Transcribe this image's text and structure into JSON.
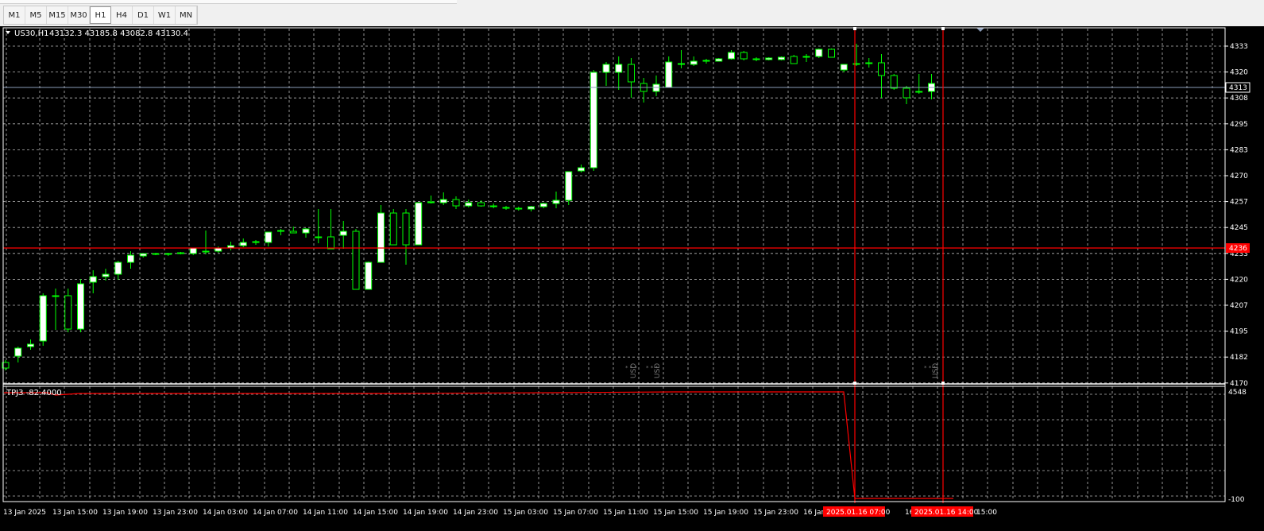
{
  "timeframes": [
    "M1",
    "M5",
    "M15",
    "M30",
    "H1",
    "H4",
    "D1",
    "W1",
    "MN"
  ],
  "active_timeframe": "H1",
  "chart": {
    "symbol_label": "US30,H1",
    "ohlc": "43132.3 43185.8 43082.8 43130.4",
    "price_axis": [
      "4333",
      "4320",
      "4308",
      "4295",
      "4283",
      "4270",
      "4257",
      "4245",
      "4233",
      "4220",
      "4207",
      "4195",
      "4182",
      "4170"
    ],
    "current_price_label": "4313",
    "red_line_price_label": "4236",
    "time_axis": [
      "13 Jan 2025",
      "13 Jan 15:00",
      "13 Jan 19:00",
      "13 Jan 23:00",
      "14 Jan 03:00",
      "14 Jan 07:00",
      "14 Jan 11:00",
      "14 Jan 15:00",
      "14 Jan 19:00",
      "14 Jan 23:00",
      "15 Jan 03:00",
      "15 Jan 07:00",
      "15 Jan 11:00",
      "15 Jan 15:00",
      "15 Jan 19:00",
      "15 Jan 23:00",
      "16 Jan",
      "16",
      "15:00"
    ],
    "vline_labels": [
      "2025.01.16 07:00",
      "2025.01.16 14:00"
    ],
    "event_label": "USD",
    "colors": {
      "background": "#000000",
      "grid": "#c0c0c0",
      "bull": "#00ff00",
      "body_fill": "#ffffff",
      "accent": "#ff0000",
      "bid_line": "#8a9bb8"
    }
  },
  "indicator": {
    "label": "TPJ3 -82.4000",
    "axis_top": "4548",
    "axis_bottom": "-100"
  }
}
